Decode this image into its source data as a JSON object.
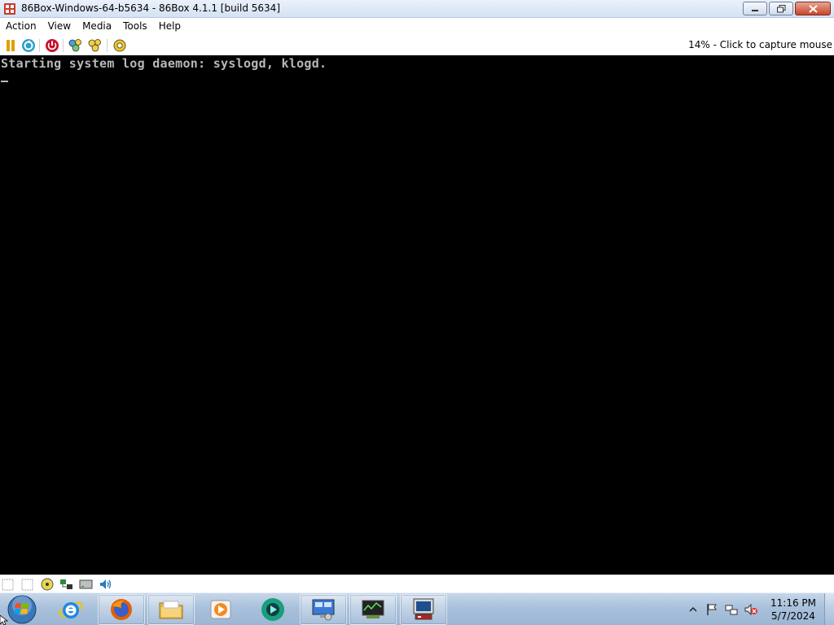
{
  "window": {
    "title": "86Box-Windows-64-b5634 - 86Box 4.1.1 [build 5634]",
    "icon": "86box-app-icon"
  },
  "menubar": {
    "items": [
      "Action",
      "View",
      "Media",
      "Tools",
      "Help"
    ]
  },
  "toolbar": {
    "buttons": [
      "pause-icon",
      "reset-icon",
      "power-icon",
      "ctrl-alt-del-icon",
      "ctrl-alt-esc-icon",
      "settings-icon"
    ],
    "status_text": "14% - Click to capture mouse"
  },
  "console": {
    "lines": [
      "Starting system log daemon: syslogd, klogd."
    ],
    "cursor_visible": true
  },
  "statusbar": {
    "icons": [
      "floppy-1-icon",
      "floppy-2-icon",
      "cdrom-icon",
      "network-icon",
      "hard-disk-icon",
      "sound-icon"
    ]
  },
  "taskbar": {
    "start": "windows-start-orb-icon",
    "apps": [
      "internet-explorer-icon",
      "firefox-icon",
      "file-explorer-icon",
      "media-player-icon",
      "app-sphere-icon",
      "remote-desktop-icon",
      "network-monitor-icon",
      "86box-taskbar-icon"
    ],
    "tray": {
      "icons": [
        "show-hidden-icons-arrow",
        "action-center-flag-icon",
        "network-tray-icon",
        "volume-muted-icon"
      ],
      "time": "11:16 PM",
      "date": "5/7/2024"
    }
  },
  "colors": {
    "console_text": "#b8b8b8",
    "console_bg": "#000000",
    "taskbar": "#a9c1dc",
    "titlebar": "#d5e2f3"
  }
}
